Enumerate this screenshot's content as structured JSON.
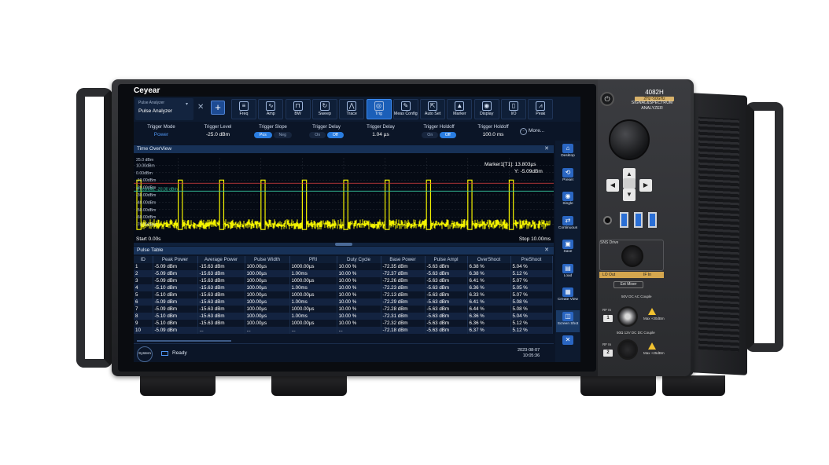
{
  "brand": "Ceyear",
  "instrument": {
    "model": "4082H",
    "band": "2Hz~50GHz",
    "subtitle_line1": "SIGNAL&SPECTRUM",
    "subtitle_line2": "ANALYZER",
    "sns_label": "SNS Drive",
    "lo_out": "LO Out",
    "if_in": "IF In",
    "ext_mixer": "Ext Mixer",
    "rf_in_1": "RF In",
    "rf_in_1_badge": "1",
    "rf_in_1_note": "50V DC  AC Couple",
    "rf_in_1_max": "Max +30dBm",
    "rf_in_2": "RF In",
    "rf_in_2_badge": "2",
    "rf_in_2_note": "50Ω  12V DC  DC Couple",
    "rf_in_2_max": "Max +25dBm"
  },
  "mode": {
    "small": "Pulse Analyzer",
    "current": "Pulse  Analyzer"
  },
  "toolbar": [
    {
      "label": "Freq",
      "icon": "freq-icon",
      "glyph": "≡",
      "active": false
    },
    {
      "label": "Amp",
      "icon": "amp-icon",
      "glyph": "∿",
      "active": false
    },
    {
      "label": "BW",
      "icon": "bw-icon",
      "glyph": "⊓",
      "active": false
    },
    {
      "label": "Sweep",
      "icon": "sweep-icon",
      "glyph": "↻",
      "active": false
    },
    {
      "label": "Trace",
      "icon": "trace-icon",
      "glyph": "⋀",
      "active": false
    },
    {
      "label": "Trig",
      "icon": "trigger-icon",
      "glyph": "◎",
      "active": true
    },
    {
      "label": "Meas Config",
      "icon": "meas-config-icon",
      "glyph": "✎",
      "active": false
    },
    {
      "label": "Auto Set",
      "icon": "auto-set-icon",
      "glyph": "⇱",
      "active": false
    },
    {
      "label": "Marker",
      "icon": "marker-icon",
      "glyph": "▲",
      "active": false
    },
    {
      "label": "Display",
      "icon": "display-icon",
      "glyph": "◉",
      "active": false
    },
    {
      "label": "I/O",
      "icon": "io-icon",
      "glyph": "▯",
      "active": false
    },
    {
      "label": "Peak",
      "icon": "peak-icon",
      "glyph": "⩘",
      "active": false
    }
  ],
  "trigger": {
    "mode_label": "Trigger Mode",
    "mode_value": "Power",
    "level_label": "Trigger Level",
    "level_value": "-25.0 dBm",
    "slope_label": "Trigger Slope",
    "slope_pos": "Pos",
    "slope_neg": "Neg",
    "delay_label": "Trigger Delay",
    "delay_on": "On",
    "delay_off": "Off",
    "delay_time_label": "Trigger Delay",
    "delay_time_value": "1.04 µs",
    "holdoff_label": "Trigger Holdoff",
    "holdoff_on": "On",
    "holdoff_off": "Off",
    "holdoff_time_label": "Trigger Holdoff",
    "holdoff_time_value": "100.0 ms",
    "more": "More..."
  },
  "sidebar": [
    {
      "label": "Desktop",
      "icon": "desktop-icon",
      "glyph": "⌂"
    },
    {
      "label": "Preset",
      "icon": "preset-icon",
      "glyph": "⟲"
    },
    {
      "label": "Single",
      "icon": "single-icon",
      "glyph": "◉"
    },
    {
      "label": "Continuous",
      "icon": "continuous-icon",
      "glyph": "⇄"
    },
    {
      "label": "Save",
      "icon": "save-icon",
      "glyph": "▣"
    },
    {
      "label": "Load",
      "icon": "load-icon",
      "glyph": "▤"
    },
    {
      "label": "Create View",
      "icon": "create-view-icon",
      "glyph": "▦"
    },
    {
      "label": "Screen Shot",
      "icon": "screenshot-icon",
      "glyph": "◫"
    },
    {
      "label": "",
      "icon": "tools-icon",
      "glyph": "✕"
    }
  ],
  "overview": {
    "title": "Time OverView",
    "ref_level": "25.0 dBm",
    "y_labels": [
      "10.00dBm",
      "0.00dBm",
      "-10.00dBm",
      "-20.00dBm",
      "-30.00dBm",
      "-40.00dBm",
      "-50.00dBm",
      "-60.00dBm",
      "-70.00dBm"
    ],
    "threshold": "Threshold: -20.00 dBm",
    "marker_line1": "Marker1[T1]:   13.803µs",
    "marker_line2": "Y: -5.09dBm",
    "start": "Start 0.00s",
    "stop": "Stop 10.00ms"
  },
  "chart_data": {
    "type": "line",
    "title": "Time OverView",
    "xlabel": "",
    "ylabel": "",
    "xlim": [
      0,
      10
    ],
    "x_unit": "ms",
    "ylim": [
      -75,
      25
    ],
    "pulse_count": 10,
    "pulse_peak_dbm": -5.09,
    "noise_floor_dbm": [
      -72,
      -58
    ],
    "threshold_dbm": -20,
    "colors": {
      "trace": "#f2f200",
      "threshold": "#37c7a0",
      "marker_line": "#e04040"
    }
  },
  "pulse_table": {
    "title": "Pulse Table",
    "columns": [
      "ID",
      "Peak Power",
      "Average Power",
      "Pulse Width",
      "PRI",
      "Duty Cycle",
      "Base Power",
      "Pulse Ampl",
      "OverShoot",
      "PreShoot"
    ],
    "rows": [
      [
        "1",
        "-5.09 dBm",
        "-15.63 dBm",
        "100.00µs",
        "1000.00µs",
        "10.00 %",
        "-72.35 dBm",
        "-5.63 dBm",
        "6.38 %",
        "5.04 %"
      ],
      [
        "2",
        "-5.09 dBm",
        "-15.63 dBm",
        "100.00µs",
        "1.00ms",
        "10.00 %",
        "-72.37 dBm",
        "-5.63 dBm",
        "6.38 %",
        "5.12 %"
      ],
      [
        "3",
        "-5.09 dBm",
        "-15.63 dBm",
        "100.00µs",
        "1000.00µs",
        "10.00 %",
        "-72.26 dBm",
        "-5.63 dBm",
        "6.41 %",
        "5.07 %"
      ],
      [
        "4",
        "-5.10 dBm",
        "-15.63 dBm",
        "100.00µs",
        "1.00ms",
        "10.00 %",
        "-72.23 dBm",
        "-5.63 dBm",
        "6.36 %",
        "5.05 %"
      ],
      [
        "5",
        "-5.10 dBm",
        "-15.63 dBm",
        "100.00µs",
        "1000.00µs",
        "10.00 %",
        "-72.13 dBm",
        "-5.63 dBm",
        "6.33 %",
        "5.07 %"
      ],
      [
        "6",
        "-5.09 dBm",
        "-15.63 dBm",
        "100.00µs",
        "1.00ms",
        "10.00 %",
        "-72.29 dBm",
        "-5.63 dBm",
        "6.41 %",
        "5.08 %"
      ],
      [
        "7",
        "-5.09 dBm",
        "-15.63 dBm",
        "100.00µs",
        "1000.00µs",
        "10.00 %",
        "-72.28 dBm",
        "-5.63 dBm",
        "6.44 %",
        "5.08 %"
      ],
      [
        "8",
        "-5.10 dBm",
        "-15.63 dBm",
        "100.00µs",
        "1.00ms",
        "10.00 %",
        "-72.31 dBm",
        "-5.63 dBm",
        "6.36 %",
        "5.04 %"
      ],
      [
        "9",
        "-5.10 dBm",
        "-15.63 dBm",
        "100.00µs",
        "1000.00µs",
        "10.00 %",
        "-72.32 dBm",
        "-5.63 dBm",
        "6.36 %",
        "5.12 %"
      ],
      [
        "10",
        "-5.09 dBm",
        "...",
        "...",
        "...",
        "...",
        "-72.18 dBm",
        "-5.63 dBm",
        "6.37 %",
        "5.12 %"
      ]
    ]
  },
  "status": {
    "system": "System",
    "ready": "Ready",
    "date": "2023-08-07",
    "time": "10:05:36"
  }
}
